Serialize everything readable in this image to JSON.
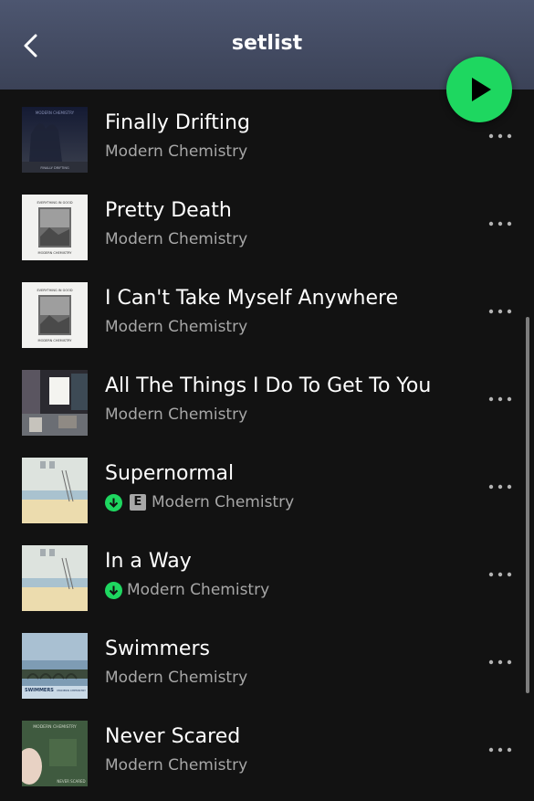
{
  "header": {
    "title": "setlist"
  },
  "colors": {
    "accent": "#1ed760",
    "header_bg": "#4d5670",
    "background": "#121212",
    "subtext": "#a7a7a7"
  },
  "icons": {
    "back": "chevron-left-icon",
    "play": "play-icon",
    "more": "more-horizontal-icon",
    "downloaded": "download-arrow-icon"
  },
  "tracks": [
    {
      "title": "Finally Drifting",
      "artist": "Modern Chemistry",
      "downloaded": false,
      "explicit": false,
      "art_text_top": "MODERN CHEMISTRY",
      "art_text_bottom": "FINALLY DRIFTING"
    },
    {
      "title": "Pretty Death",
      "artist": "Modern Chemistry",
      "downloaded": false,
      "explicit": false,
      "art_text_top": "EVERYTHING IN GOOD",
      "art_text_bottom": "MODERN CHEMISTRY"
    },
    {
      "title": "I Can't Take Myself Anywhere",
      "artist": "Modern Chemistry",
      "downloaded": false,
      "explicit": false,
      "art_text_top": "EVERYTHING IN GOOD",
      "art_text_bottom": "MODERN CHEMISTRY"
    },
    {
      "title": "All The Things I Do To Get To You",
      "artist": "Modern Chemistry",
      "downloaded": false,
      "explicit": false
    },
    {
      "title": "Supernormal",
      "artist": "Modern Chemistry",
      "downloaded": true,
      "explicit": true,
      "explicit_label": "E"
    },
    {
      "title": "In a Way",
      "artist": "Modern Chemistry",
      "downloaded": true,
      "explicit": false
    },
    {
      "title": "Swimmers",
      "artist": "Modern Chemistry",
      "downloaded": false,
      "explicit": false,
      "art_text_top": "SWIMMERS",
      "art_text_bottom": "MODERN CHEMISTRY"
    },
    {
      "title": "Never Scared",
      "artist": "Modern Chemistry",
      "downloaded": false,
      "explicit": false,
      "art_text_top": "MODERN CHEMISTRY",
      "art_text_bottom": "NEVER SCARED"
    }
  ]
}
